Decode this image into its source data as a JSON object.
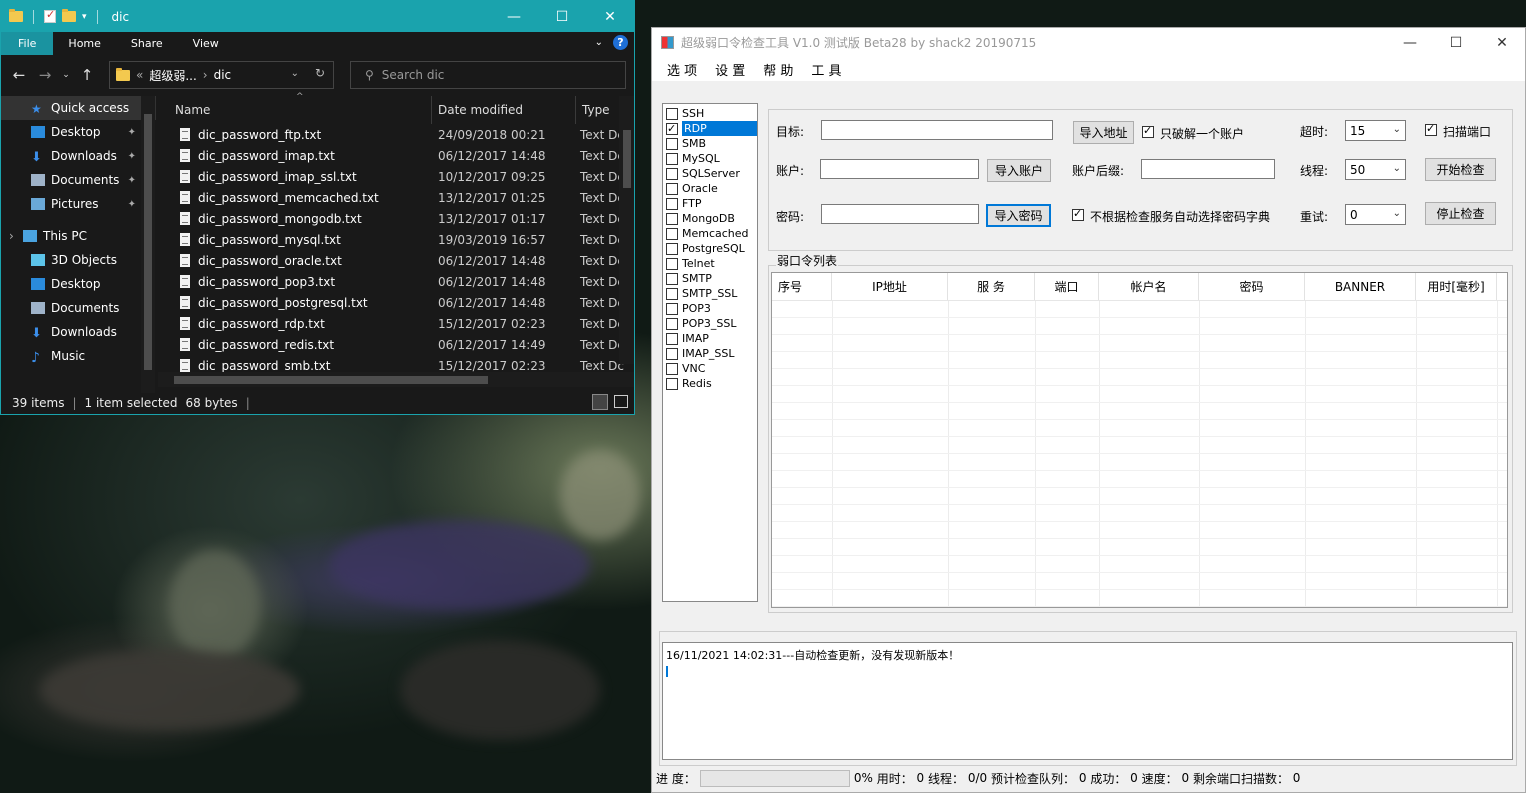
{
  "explorer": {
    "title": "dic",
    "ribbon_tabs": [
      "File",
      "Home",
      "Share",
      "View"
    ],
    "breadcrumb": {
      "prefix": "«",
      "parent": "超级弱...",
      "sep": "›",
      "current": "dic"
    },
    "search_placeholder": "Search dic",
    "nav": [
      {
        "label": "Quick access",
        "icon": "star-icon",
        "pinned": false,
        "selected": true,
        "pc": false
      },
      {
        "label": "Desktop",
        "icon": "desktop-icon",
        "pinned": true
      },
      {
        "label": "Downloads",
        "icon": "download-icon",
        "pinned": true
      },
      {
        "label": "Documents",
        "icon": "documents-icon",
        "pinned": true
      },
      {
        "label": "Pictures",
        "icon": "pictures-icon",
        "pinned": true
      },
      {
        "label": "This PC",
        "icon": "computer-icon",
        "pinned": false,
        "pc": true
      },
      {
        "label": "3D Objects",
        "icon": "cube-icon",
        "pinned": false
      },
      {
        "label": "Desktop",
        "icon": "desktop-icon",
        "pinned": false
      },
      {
        "label": "Documents",
        "icon": "documents-icon",
        "pinned": false
      },
      {
        "label": "Downloads",
        "icon": "download-icon",
        "pinned": false
      },
      {
        "label": "Music",
        "icon": "music-icon",
        "pinned": false
      }
    ],
    "columns": [
      "Name",
      "Date modified",
      "Type"
    ],
    "files": [
      {
        "name": "dic_password_ftp.txt",
        "date": "24/09/2018 00:21",
        "type": "Text Dc"
      },
      {
        "name": "dic_password_imap.txt",
        "date": "06/12/2017 14:48",
        "type": "Text Dc"
      },
      {
        "name": "dic_password_imap_ssl.txt",
        "date": "10/12/2017 09:25",
        "type": "Text Dc"
      },
      {
        "name": "dic_password_memcached.txt",
        "date": "13/12/2017 01:25",
        "type": "Text Dc"
      },
      {
        "name": "dic_password_mongodb.txt",
        "date": "13/12/2017 01:17",
        "type": "Text Dc"
      },
      {
        "name": "dic_password_mysql.txt",
        "date": "19/03/2019 16:57",
        "type": "Text Dc"
      },
      {
        "name": "dic_password_oracle.txt",
        "date": "06/12/2017 14:48",
        "type": "Text Dc"
      },
      {
        "name": "dic_password_pop3.txt",
        "date": "06/12/2017 14:48",
        "type": "Text Dc"
      },
      {
        "name": "dic_password_postgresql.txt",
        "date": "06/12/2017 14:48",
        "type": "Text Dc"
      },
      {
        "name": "dic_password_rdp.txt",
        "date": "15/12/2017 02:23",
        "type": "Text Dc"
      },
      {
        "name": "dic_password_redis.txt",
        "date": "06/12/2017 14:49",
        "type": "Text Dc"
      },
      {
        "name": "dic_password_smb.txt",
        "date": "15/12/2017 02:23",
        "type": "Text Dc"
      }
    ],
    "status": {
      "items": "39 items",
      "selected": "1 item selected",
      "size": "68 bytes"
    }
  },
  "app": {
    "title": "超级弱口令检查工具 V1.0 测试版 Beta28 by shack2 20190715",
    "menu": [
      "选 项",
      "设 置",
      "帮 助",
      "工 具"
    ],
    "services": [
      {
        "label": "SSH",
        "checked": false
      },
      {
        "label": "RDP",
        "checked": true,
        "selected": true
      },
      {
        "label": "SMB",
        "checked": false
      },
      {
        "label": "MySQL",
        "checked": false
      },
      {
        "label": "SQLServer",
        "checked": false
      },
      {
        "label": "Oracle",
        "checked": false
      },
      {
        "label": "FTP",
        "checked": false
      },
      {
        "label": "MongoDB",
        "checked": false
      },
      {
        "label": "Memcached",
        "checked": false
      },
      {
        "label": "PostgreSQL",
        "checked": false
      },
      {
        "label": "Telnet",
        "checked": false
      },
      {
        "label": "SMTP",
        "checked": false
      },
      {
        "label": "SMTP_SSL",
        "checked": false
      },
      {
        "label": "POP3",
        "checked": false
      },
      {
        "label": "POP3_SSL",
        "checked": false
      },
      {
        "label": "IMAP",
        "checked": false
      },
      {
        "label": "IMAP_SSL",
        "checked": false
      },
      {
        "label": "VNC",
        "checked": false
      },
      {
        "label": "Redis",
        "checked": false
      }
    ],
    "form": {
      "target_label": "目标:",
      "account_label": "账户:",
      "password_label": "密码:",
      "import_addr": "导入地址",
      "import_account": "导入账户",
      "import_password": "导入密码",
      "crack_one": "只破解一个账户",
      "suffix_label": "账户后缀:",
      "no_auto_dict": "不根据检查服务自动选择密码字典",
      "timeout_label": "超时:",
      "timeout_value": "15",
      "threads_label": "线程:",
      "threads_value": "50",
      "retry_label": "重试:",
      "retry_value": "0",
      "scan_port": "扫描端口",
      "start": "开始检查",
      "stop": "停止检查"
    },
    "list_title": "弱口令列表",
    "columns": [
      "序号",
      "IP地址",
      "服 务",
      "端口",
      "帐户名",
      "密码",
      "BANNER",
      "用时[毫秒]"
    ],
    "log": "16/11/2021 14:02:31---自动检查更新，没有发现新版本！",
    "status": {
      "progress_label": "进 度：",
      "pct": "0%",
      "time_label": "用时：",
      "time": "0",
      "thread_label": "线程：",
      "thread": "0/0",
      "queue_label": "预计检查队列：",
      "queue": "0",
      "success_label": "成功：",
      "success": "0",
      "speed_label": "速度：",
      "speed": "0",
      "remain_label": "剩余端口扫描数：",
      "remain": "0"
    }
  }
}
